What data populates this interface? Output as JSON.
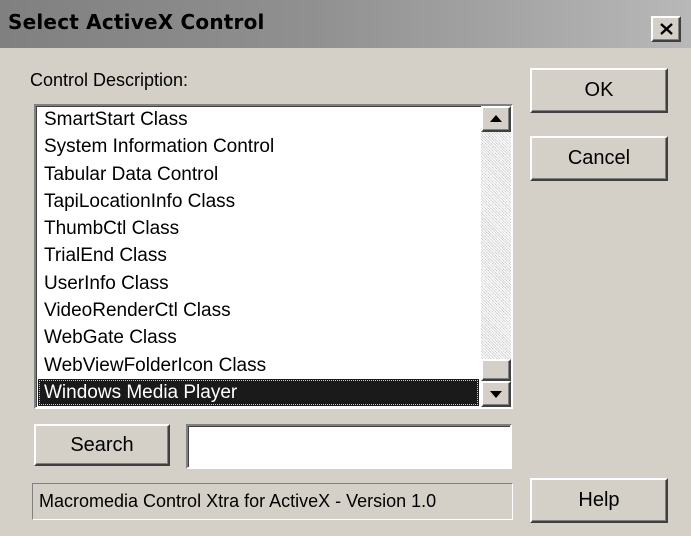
{
  "window": {
    "title": "Select ActiveX Control",
    "close_glyph": "close-icon"
  },
  "list": {
    "label": "Control Description:",
    "items": [
      "SmartStart Class",
      "System Information Control",
      "Tabular Data Control",
      "TapiLocationInfo Class",
      "ThumbCtl Class",
      "TrialEnd Class",
      "UserInfo Class",
      "VideoRenderCtl Class",
      "WebGate Class",
      "WebViewFolderIcon Class",
      "Windows Media Player"
    ],
    "selected_index": 10,
    "scroll_position": 1.0
  },
  "buttons": {
    "ok": "OK",
    "cancel": "Cancel",
    "search": "Search",
    "help": "Help"
  },
  "search": {
    "value": "",
    "placeholder": ""
  },
  "status": {
    "text": "Macromedia Control Xtra for ActiveX - Version 1.0"
  },
  "colors": {
    "dialog_face": "#d4d0c8",
    "title_bar": "#909090",
    "selection": "#1a1a1a"
  },
  "icons": {
    "close": "close-icon",
    "scroll_up": "arrow-up-icon",
    "scroll_down": "arrow-down-icon"
  }
}
